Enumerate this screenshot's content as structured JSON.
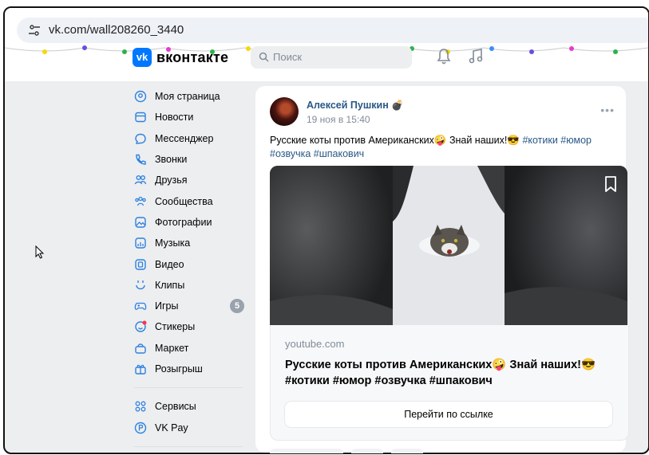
{
  "browser": {
    "url": "vk.com/wall208260_3440"
  },
  "header": {
    "logo_letter": "vk",
    "logo_text": "вконтакте",
    "search_placeholder": "Поиск"
  },
  "sidebar": {
    "items": [
      {
        "label": "Моя страница",
        "icon": "user-circle-icon"
      },
      {
        "label": "Новости",
        "icon": "news-icon"
      },
      {
        "label": "Мессенджер",
        "icon": "chat-icon"
      },
      {
        "label": "Звонки",
        "icon": "phone-icon"
      },
      {
        "label": "Друзья",
        "icon": "friends-icon"
      },
      {
        "label": "Сообщества",
        "icon": "communities-icon"
      },
      {
        "label": "Фотографии",
        "icon": "photos-icon"
      },
      {
        "label": "Музыка",
        "icon": "music-icon"
      },
      {
        "label": "Видео",
        "icon": "video-icon"
      },
      {
        "label": "Клипы",
        "icon": "clips-icon"
      },
      {
        "label": "Игры",
        "icon": "games-icon",
        "badge": "5"
      },
      {
        "label": "Стикеры",
        "icon": "stickers-icon"
      },
      {
        "label": "Маркет",
        "icon": "market-icon"
      },
      {
        "label": "Розыгрыш",
        "icon": "gift-icon"
      }
    ],
    "items2": [
      {
        "label": "Сервисы",
        "icon": "services-icon"
      },
      {
        "label": "VK Pay",
        "icon": "vkpay-icon"
      }
    ]
  },
  "post": {
    "author": "Алексей Пушкин",
    "time": "19 ноя в 15:40",
    "text_main": "Русские коты против Американских",
    "text_emoji1": "🤪",
    "text_mid": " Знай наших!",
    "text_emoji2": "😎",
    "tags": " #котики #юмор #озвучка #шпакович",
    "link": {
      "domain": "youtube.com",
      "title_a": "Русские коты против Американских",
      "emoji1": "🤪",
      "title_b": " Знай наших!",
      "emoji2": "😎",
      "title_c": " #котики #юмор #озвучка #шпакович",
      "button": "Перейти по ссылке"
    }
  },
  "colors": {
    "accent": "#0077ff",
    "link": "#2a5885",
    "bg": "#edeef0"
  }
}
